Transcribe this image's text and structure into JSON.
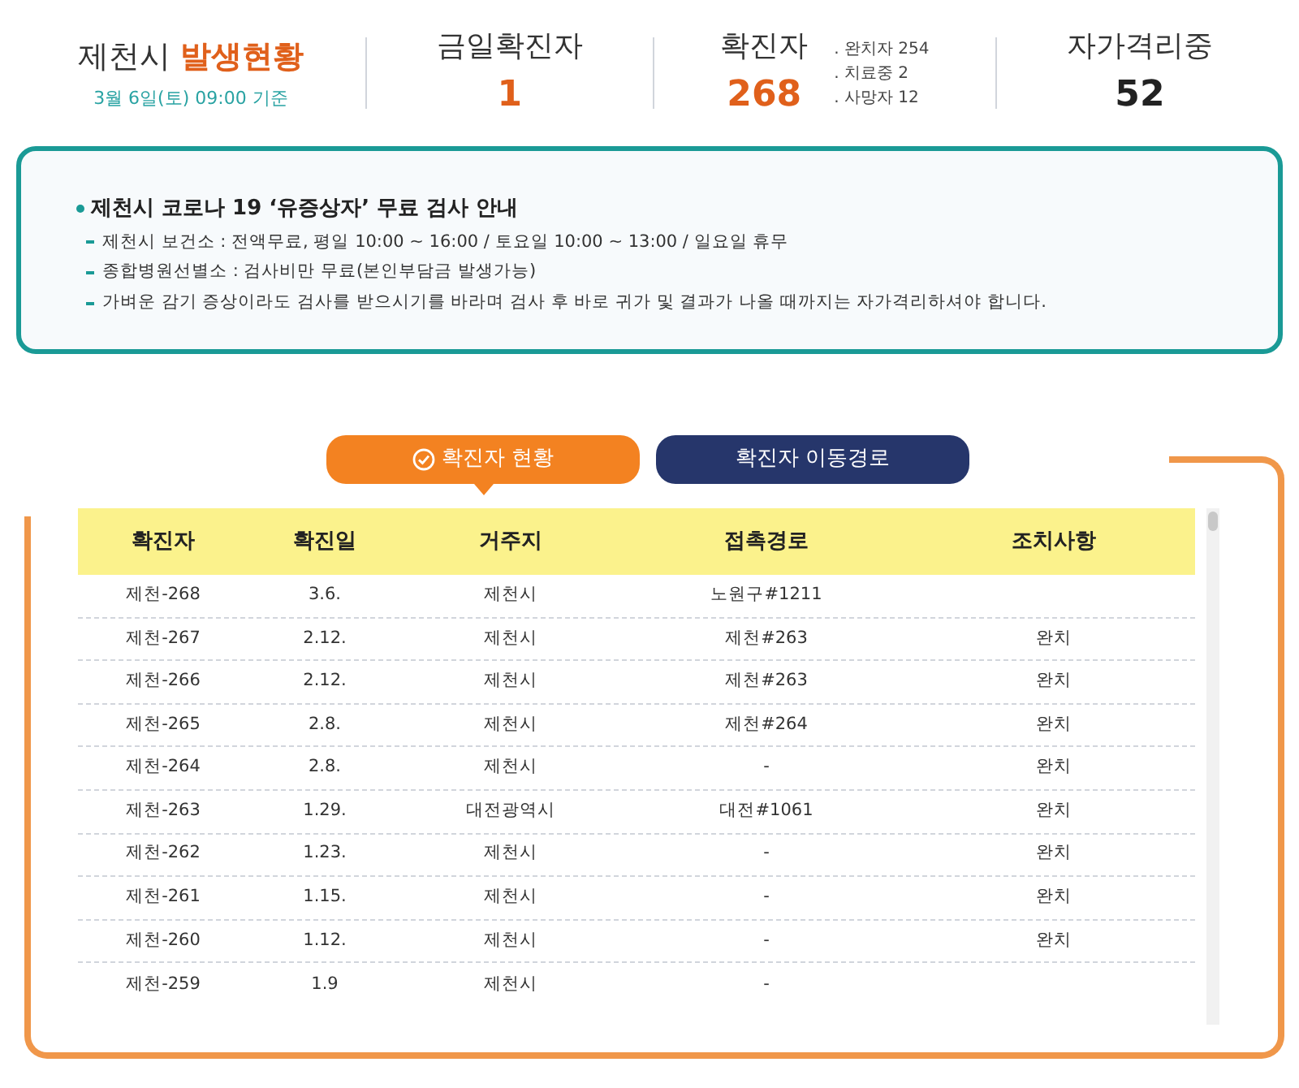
{
  "header": {
    "title_plain": "제천시",
    "title_accent": "발생현황",
    "date": "3월 6일(토) 09:00 기준",
    "stats": [
      {
        "label": "금일확진자",
        "value": "1",
        "kind": "accent"
      },
      {
        "label": "확진자",
        "value": "268",
        "kind": "accent",
        "details": [
          ". 완치자 254",
          ". 치료중 2",
          ". 사망자 12"
        ]
      },
      {
        "label": "자가격리중",
        "value": "52",
        "kind": "plain"
      }
    ]
  },
  "notice": {
    "title": "제천시 코로나 19 ‘유증상자’ 무료 검사 안내",
    "lines": [
      "제천시 보건소 : 전액무료, 평일 10:00 ~ 16:00 / 토요일 10:00 ~ 13:00 / 일요일 휴무",
      "종합병원선별소 : 검사비만 무료(본인부담금 발생가능)",
      "가벼운 감기 증상이라도 검사를 받으시기를 바라며 검사 후 바로 귀가 및 결과가 나올 때까지는 자가격리하셔야 합니다."
    ]
  },
  "tabs": [
    {
      "label": "확진자 현황",
      "selected": true
    },
    {
      "label": "확진자 이동경로",
      "selected": false
    }
  ],
  "table": {
    "columns": [
      "확진자",
      "확진일",
      "거주지",
      "접촉경로",
      "조치사항"
    ],
    "rows": [
      [
        "제천-268",
        "3.6.",
        "제천시",
        "노원구#1211",
        ""
      ],
      [
        "제천-267",
        "2.12.",
        "제천시",
        "제천#263",
        "완치"
      ],
      [
        "제천-266",
        "2.12.",
        "제천시",
        "제천#263",
        "완치"
      ],
      [
        "제천-265",
        "2.8.",
        "제천시",
        "제천#264",
        "완치"
      ],
      [
        "제천-264",
        "2.8.",
        "제천시",
        "-",
        "완치"
      ],
      [
        "제천-263",
        "1.29.",
        "대전광역시",
        "대전#1061",
        "완치"
      ],
      [
        "제천-262",
        "1.23.",
        "제천시",
        "-",
        "완치"
      ],
      [
        "제천-261",
        "1.15.",
        "제천시",
        "-",
        "완치"
      ],
      [
        "제천-260",
        "1.12.",
        "제천시",
        "-",
        "완치"
      ],
      [
        "제천-259",
        "1.9",
        "제천시",
        "-",
        ""
      ]
    ]
  }
}
